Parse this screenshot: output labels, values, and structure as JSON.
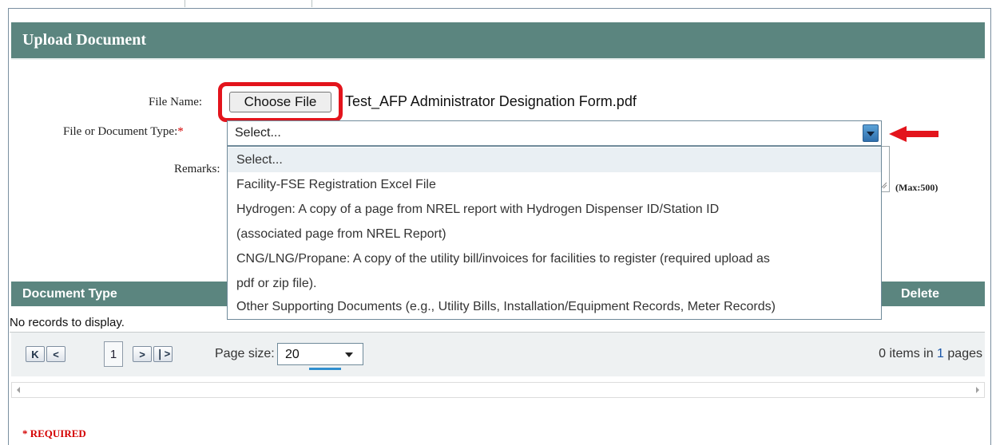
{
  "panel": {
    "title": "Upload Document"
  },
  "form": {
    "file_name_label": "File Name:",
    "choose_file_label": "Choose File",
    "chosen_file": "Test_AFP Administrator Designation Form.pdf",
    "doc_type_label": "File or Document Type:",
    "required_star": "*",
    "doc_type_value": "Select...",
    "remarks_label": "Remarks:",
    "remarks_max": "(Max:500)"
  },
  "dropdown": {
    "options": [
      "Select...",
      "Facility-FSE Registration Excel File",
      "Hydrogen: A copy of a page from NREL report with Hydrogen Dispenser ID/Station ID",
      "(associated page from NREL Report)",
      "CNG/LNG/Propane: A copy of the utility bill/invoices for facilities to register (required upload as",
      "pdf or zip file).",
      "Other Supporting Documents (e.g., Utility Bills, Installation/Equipment Records, Meter Records)"
    ],
    "selected_index": 0
  },
  "grid": {
    "columns": {
      "document_type": "Document Type",
      "delete": "Delete"
    },
    "empty_text": "No records to display.",
    "pager": {
      "first": "K",
      "prev": "<",
      "current_page": "1",
      "next": ">",
      "last": "❘>",
      "page_size_label": "Page size:",
      "page_size_value": "20",
      "items_count": "0",
      "items_text_mid": " items in ",
      "pages_count": "1",
      "items_text_end": " pages"
    }
  },
  "footer": {
    "required_note": "* REQUIRED"
  },
  "colors": {
    "header_bg": "#5b857f",
    "highlight_red": "#e3141c",
    "required_red": "#d40000"
  },
  "icons": {
    "dropdown_arrow": "chevron-down-icon",
    "annotation_arrow": "red-arrow-icon"
  }
}
